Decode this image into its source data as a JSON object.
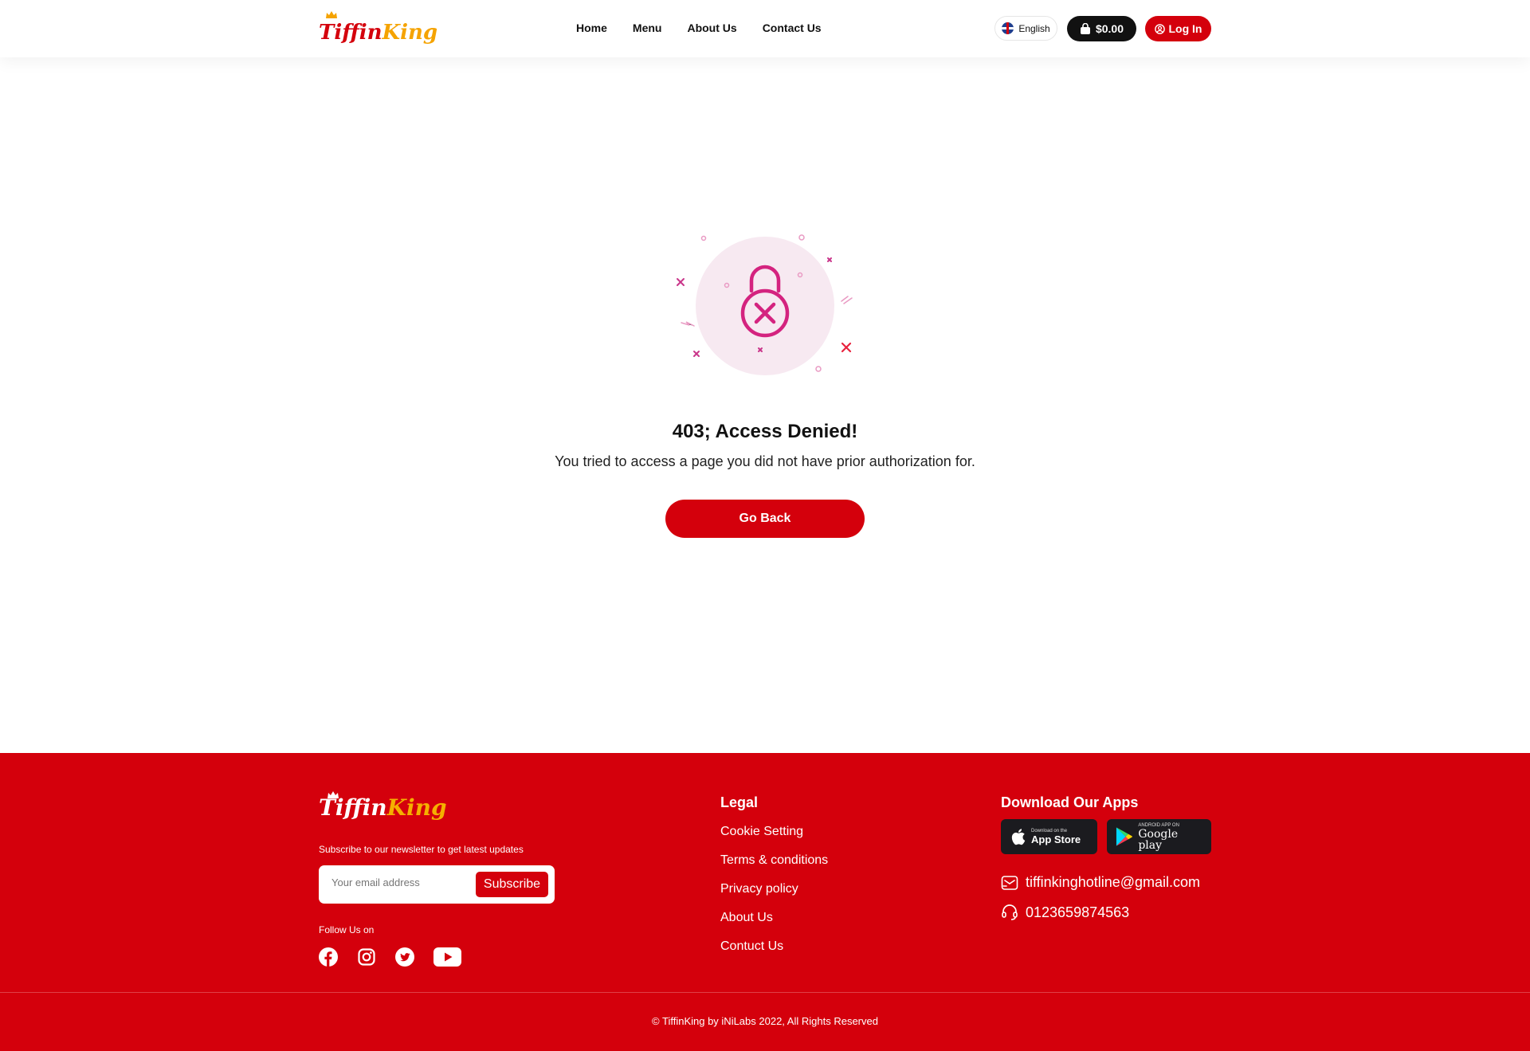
{
  "brand": {
    "name_part1": "Tiffin",
    "name_part2": "King"
  },
  "nav": {
    "items": [
      {
        "label": "Home"
      },
      {
        "label": "Menu"
      },
      {
        "label": "About Us"
      },
      {
        "label": "Contact Us"
      }
    ]
  },
  "header_actions": {
    "language": "English",
    "cart_total": "$0.00",
    "login_label": "Log In"
  },
  "error": {
    "title": "403; Access Denied!",
    "description": "You tried to access a page you did not have prior authorization for.",
    "button_label": "Go Back"
  },
  "footer": {
    "newsletter_text": "Subscribe to our newsletter to get latest updates",
    "email_placeholder": "Your email address",
    "subscribe_label": "Subscribe",
    "follow_label": "Follow Us on",
    "socials": [
      "facebook-icon",
      "instagram-icon",
      "twitter-icon",
      "youtube-icon"
    ],
    "legal": {
      "title": "Legal",
      "links": [
        {
          "label": "Cookie Setting"
        },
        {
          "label": "Terms & conditions"
        },
        {
          "label": "Privacy policy"
        },
        {
          "label": "About Us"
        },
        {
          "label": "Contuct Us"
        }
      ]
    },
    "apps": {
      "title": "Download Our Apps",
      "app_store_small": "Download on the",
      "app_store_big": "App Store",
      "google_small": "ANDROID APP ON",
      "google_big": "Google play"
    },
    "email": "tiffinkinghotline@gmail.com",
    "phone": "0123659874563",
    "copyright": "© TiffinKing by iNiLabs 2022, All Rights Reserved"
  },
  "colors": {
    "brand_red": "#d4000c",
    "brand_gold": "#f5a300",
    "lock_magenta": "#d4237f",
    "dark": "#111111"
  }
}
